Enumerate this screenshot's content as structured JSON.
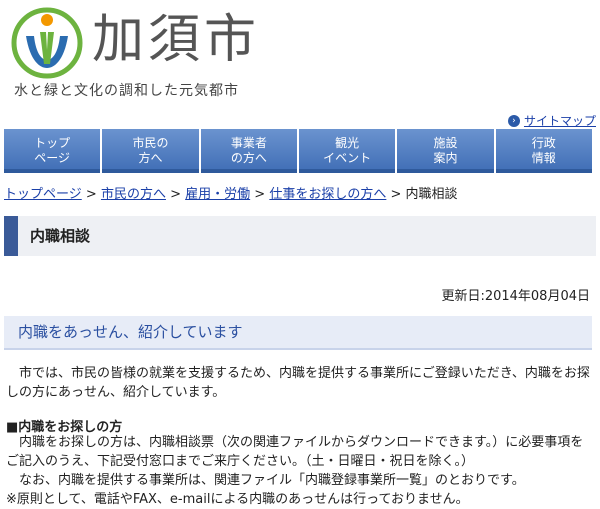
{
  "header": {
    "city_name": "加須市",
    "tagline": "水と緑と文化の調和した元気都市"
  },
  "sitemap": {
    "label": "サイトマップ"
  },
  "nav": [
    {
      "label": "トップ\nページ"
    },
    {
      "label": "市民の\n方へ"
    },
    {
      "label": "事業者\nの方へ"
    },
    {
      "label": "観光\nイベント"
    },
    {
      "label": "施設\n案内"
    },
    {
      "label": "行政\n情報"
    }
  ],
  "breadcrumb": {
    "items": [
      "トップページ",
      "市民の方へ",
      "雇用・労働",
      "仕事をお探しの方へ"
    ],
    "separator": ">",
    "current": "内職相談"
  },
  "page_title": "内職相談",
  "updated": "更新日:2014年08月04日",
  "section": {
    "heading": "内職をあっせん、紹介しています",
    "paragraph": "　市では、市民の皆様の就業を支援するため、内職を提供する事業所にご登録いただき、内職をお探しの方にあっせん、紹介しています。",
    "subheading": "■内職をお探しの方",
    "lines": [
      "　内職をお探しの方は、内職相談票（次の関連ファイルからダウンロードできます。）に必要事項をご記入のうえ、下記受付窓口までご来庁ください。（土・日曜日・祝日を除く。）",
      "　なお、内職を提供する事業所は、関連ファイル「内職登録事業所一覧」のとおりです。",
      "※原則として、電話やFAX、e-mailによる内職のあっせんは行っておりません。"
    ]
  },
  "colors": {
    "nav": "#4a78bd",
    "accent": "#3a5a98",
    "link": "#1a3fa8",
    "logo_green": "#6db33f",
    "logo_blue": "#2b6cb0",
    "logo_orange": "#f39800"
  }
}
